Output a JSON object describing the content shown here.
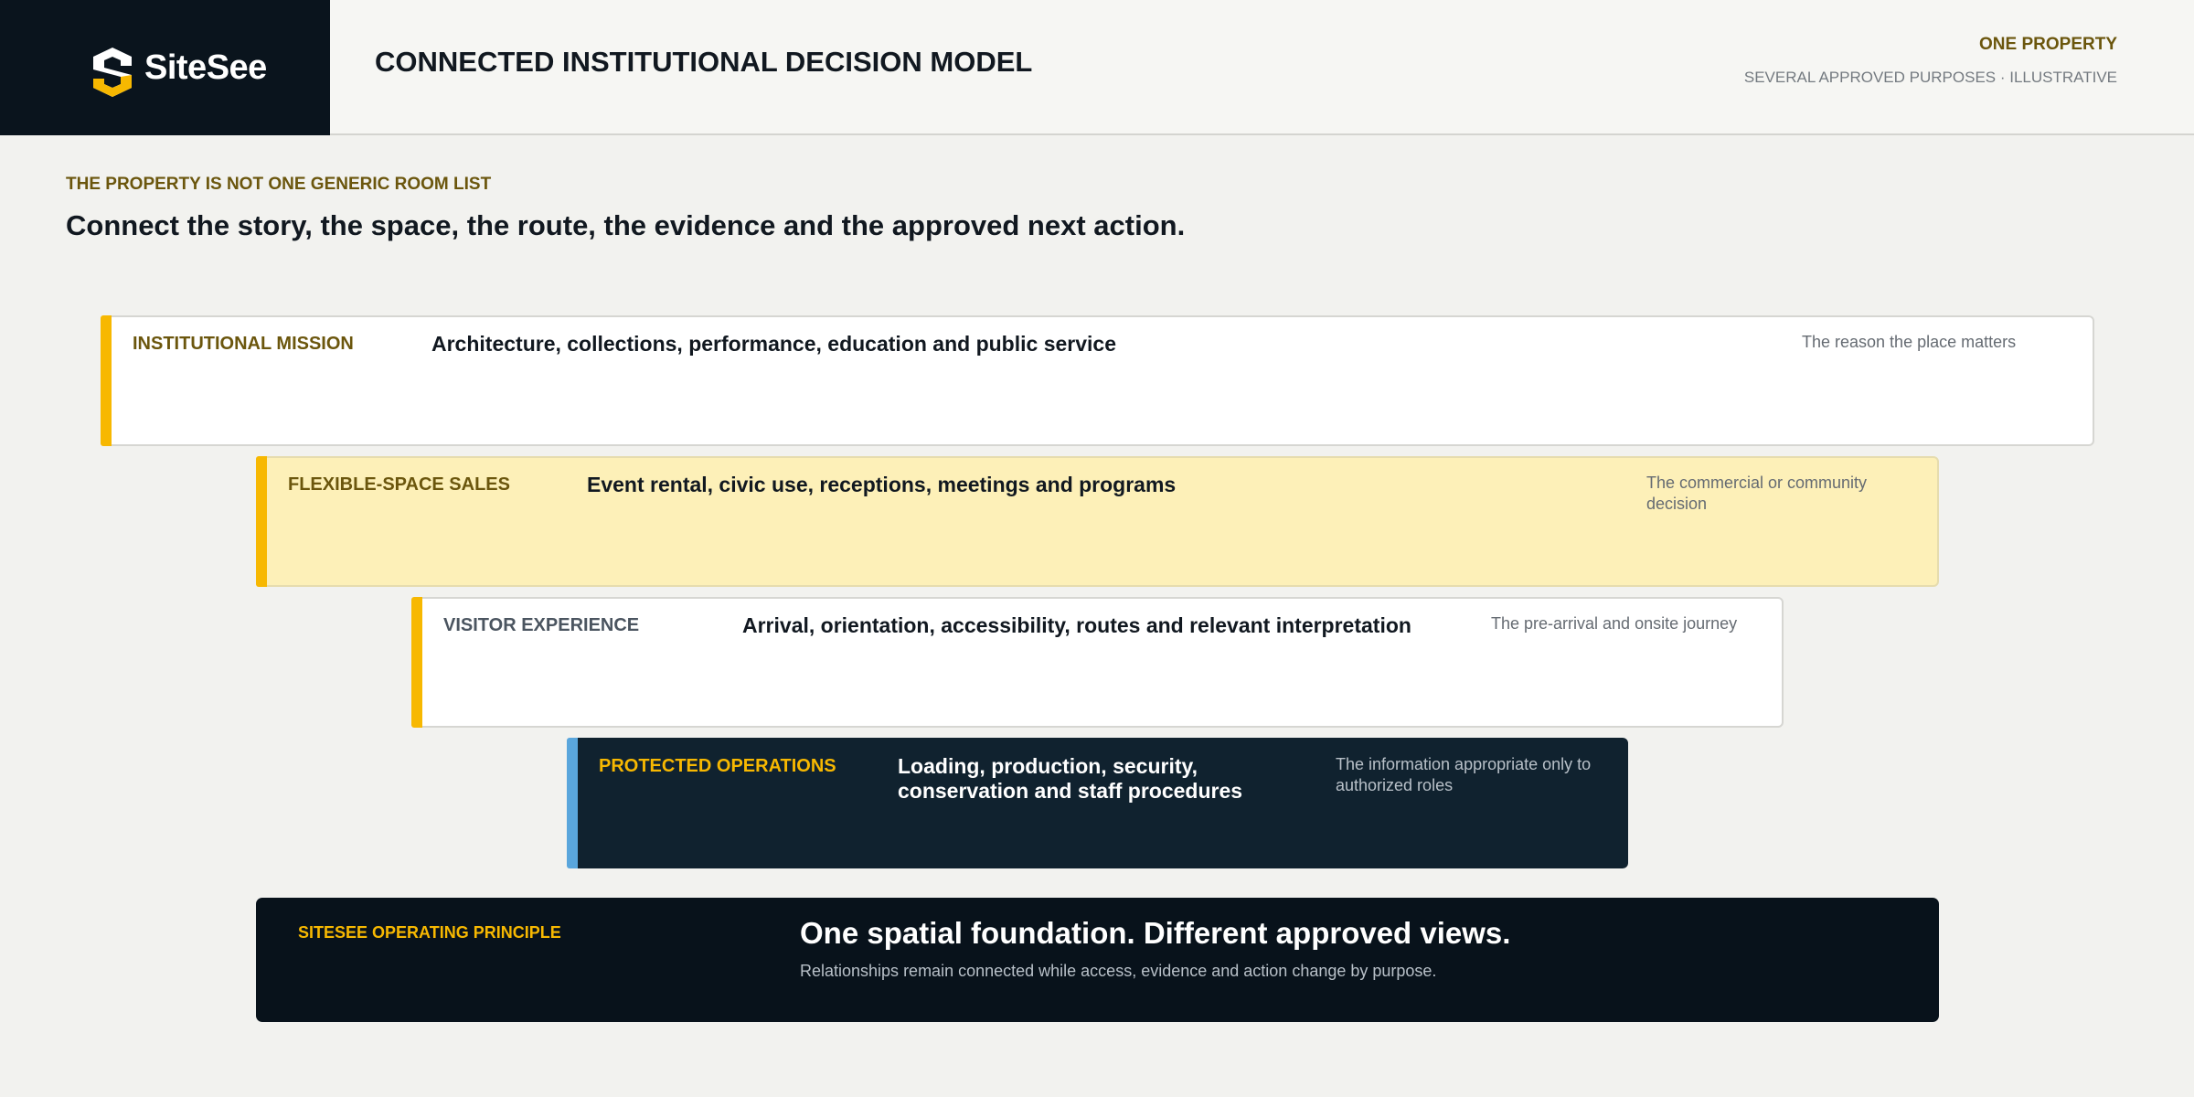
{
  "brand": {
    "name": "SiteSee",
    "accent": "#f7b801",
    "dark": "#0a141d"
  },
  "header": {
    "title": "CONNECTED INSTITUTIONAL DECISION MODEL",
    "right_primary": "ONE PROPERTY",
    "right_secondary": "SEVERAL APPROVED PURPOSES · ILLUSTRATIVE"
  },
  "intro": {
    "eyebrow": "THE PROPERTY IS NOT ONE GENERIC ROOM LIST",
    "headline": "Connect the story, the space, the route, the evidence and the approved next action."
  },
  "layers": [
    {
      "label": "INSTITUTIONAL MISSION",
      "description": "Architecture, collections, performance, education and public service",
      "note": "The reason the place matters"
    },
    {
      "label": "FLEXIBLE-SPACE SALES",
      "description": "Event rental, civic use, receptions, meetings and programs",
      "note": "The commercial or community decision"
    },
    {
      "label": "VISITOR EXPERIENCE",
      "description": "Arrival, orientation, accessibility, routes and relevant interpretation",
      "note": "The pre-arrival and onsite journey"
    },
    {
      "label": "PROTECTED OPERATIONS",
      "description": "Loading, production, security, conservation and staff procedures",
      "note": "The information appropriate only to authorized roles"
    }
  ],
  "principle": {
    "label": "SITESEE OPERATING PRINCIPLE",
    "title": "One spatial foundation. Different approved views.",
    "subtitle": "Relationships remain connected while access, evidence and action change by purpose."
  }
}
